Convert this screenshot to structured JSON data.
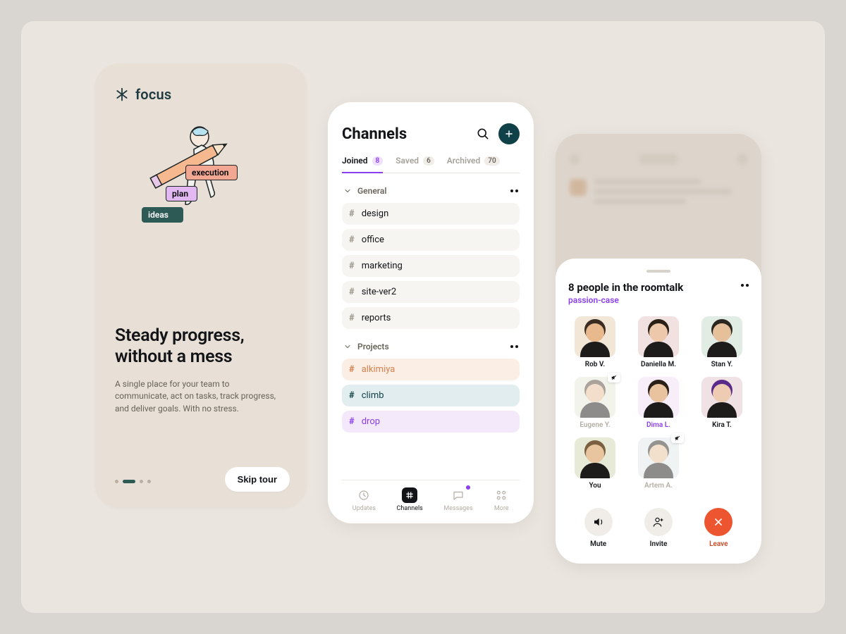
{
  "onboarding": {
    "brand": "focus",
    "step_execution": "execution",
    "step_plan": "plan",
    "step_ideas": "ideas",
    "headline_line1": "Steady progress,",
    "headline_line2": "without a mess",
    "body": "A single place for your team to communicate, act on tasks, track progress, and deliver goals. With no stress.",
    "skip_label": "Skip tour",
    "page_index": 1,
    "page_count": 4
  },
  "channels": {
    "title": "Channels",
    "tabs": [
      {
        "label": "Joined",
        "count": "8",
        "active": true
      },
      {
        "label": "Saved",
        "count": "6",
        "active": false
      },
      {
        "label": "Archived",
        "count": "70",
        "active": false
      }
    ],
    "section_general": "General",
    "general_items": [
      "design",
      "office",
      "marketing",
      "site-ver2",
      "reports"
    ],
    "section_projects": "Projects",
    "project_items": [
      {
        "name": "alkimiya",
        "tone": "orange"
      },
      {
        "name": "climb",
        "tone": "teal"
      },
      {
        "name": "drop",
        "tone": "violet"
      }
    ],
    "tabbar": {
      "updates": "Updates",
      "channels": "Channels",
      "messages": "Messages",
      "more": "More"
    }
  },
  "roomtalk": {
    "title": "8 people in the roomtalk",
    "subtitle": "passion-case",
    "people": [
      {
        "name": "Rob V.",
        "bg": "#f2e6d6",
        "skin": "#e8b98c",
        "hair": "#3a2c20"
      },
      {
        "name": "Daniella M.",
        "bg": "#f2e1e1",
        "skin": "#eec8aa",
        "hair": "#2b2016"
      },
      {
        "name": "Stan Y.",
        "bg": "#e1ece4",
        "skin": "#e6c09a",
        "hair": "#2b2620"
      },
      {
        "name": "Eugene Y.",
        "bg": "#e7ead9",
        "skin": "#e7bf97",
        "hair": "#5a483a",
        "muted": true
      },
      {
        "name": "Dima L.",
        "bg": "#f7eef9",
        "skin": "#e9c2a0",
        "hair": "#2a2018",
        "active": true
      },
      {
        "name": "Kira T.",
        "bg": "#efe1e4",
        "skin": "#eeccb3",
        "hair": "#5a2a8a"
      },
      {
        "name": "You",
        "bg": "#e6ead7",
        "skin": "#e9c59f",
        "hair": "#7a6040"
      },
      {
        "name": "Artem A.",
        "bg": "#e1e8ea",
        "skin": "#e7c29c",
        "hair": "#2e2a24",
        "muted": true
      }
    ],
    "actions": {
      "mute": "Mute",
      "invite": "Invite",
      "leave": "Leave"
    }
  },
  "colors": {
    "accent_purple": "#8a3ff0",
    "accent_teal": "#114148",
    "danger": "#ed5530"
  }
}
